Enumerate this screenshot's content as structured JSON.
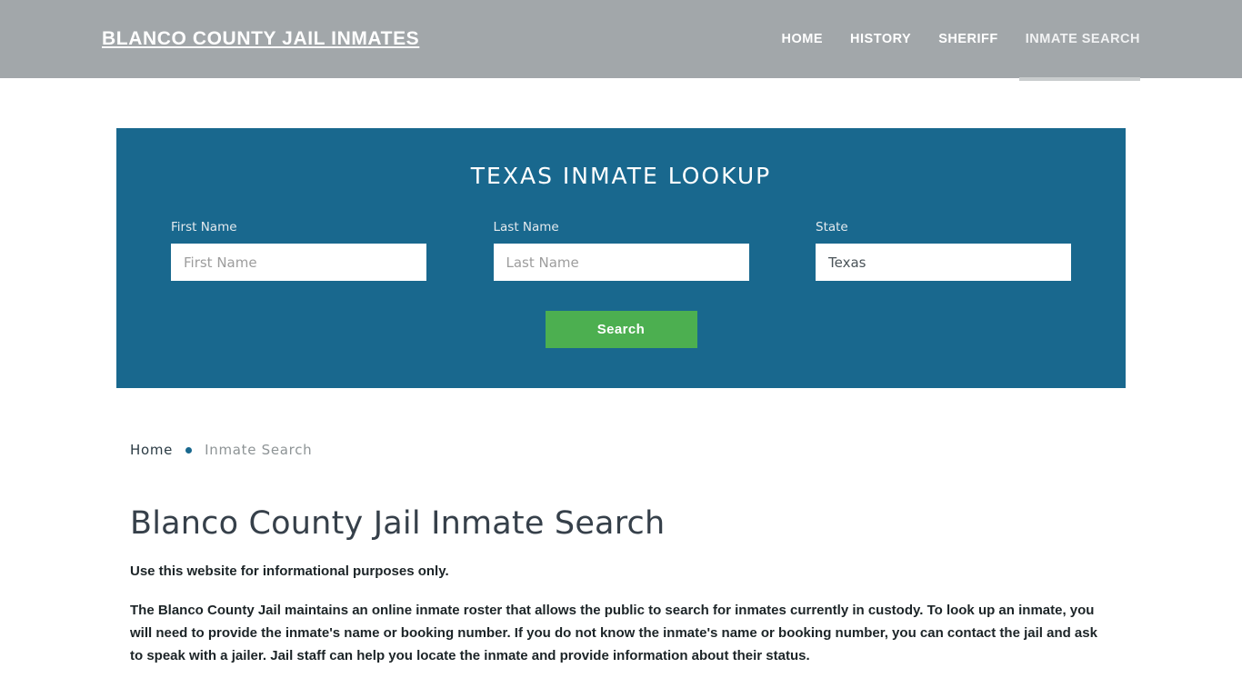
{
  "header": {
    "brand": "BLANCO COUNTY JAIL INMATES",
    "nav": [
      {
        "label": "HOME",
        "active": false
      },
      {
        "label": "HISTORY",
        "active": false
      },
      {
        "label": "SHERIFF",
        "active": false
      },
      {
        "label": "INMATE SEARCH",
        "active": true
      }
    ]
  },
  "hero": {
    "title": "TEXAS INMATE LOOKUP",
    "fields": [
      {
        "label": "First Name",
        "placeholder": "First Name",
        "value": ""
      },
      {
        "label": "Last Name",
        "placeholder": "Last Name",
        "value": ""
      },
      {
        "label": "State",
        "placeholder": "State",
        "value": "Texas"
      }
    ],
    "submit_label": "Search",
    "panel_color": "#19688e",
    "submit_color": "#4caf50"
  },
  "breadcrumb": {
    "home": "Home",
    "separator": "bullet-dot",
    "current": "Inmate Search"
  },
  "main": {
    "title": "Blanco County Jail Inmate Search",
    "lead": "Use this website for informational purposes only.",
    "paragraph": "The Blanco County Jail maintains an online inmate roster that allows the public to search for inmates currently in custody. To look up an inmate, you will need to provide the inmate's name or booking number. If you do not know the inmate's name or booking number, you can contact the jail and ask to speak with a jailer. Jail staff can help you locate the inmate and provide information about their status."
  }
}
